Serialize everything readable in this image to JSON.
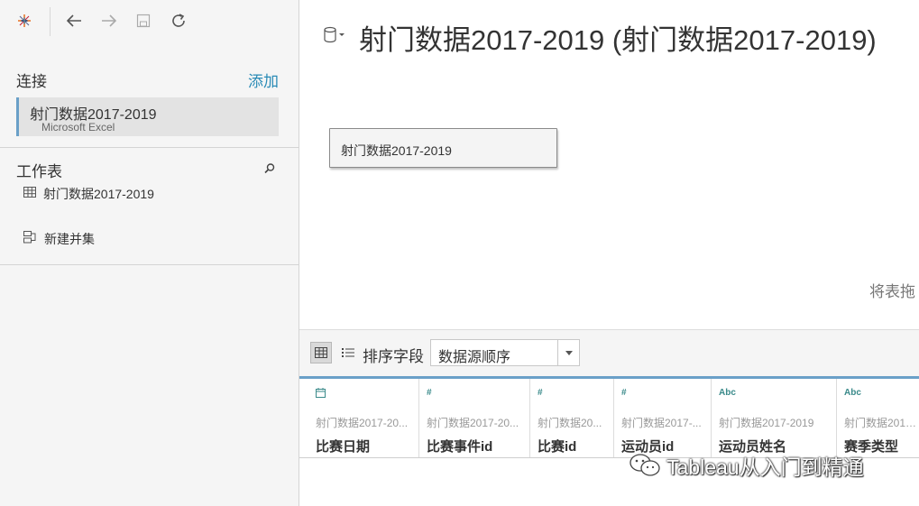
{
  "left_pane": {
    "connections_heading": "连接",
    "add_label": "添加",
    "connection": {
      "name": "射门数据2017-2019",
      "type": "Microsoft Excel"
    },
    "sheets_heading": "工作表",
    "sheet": {
      "name": "射门数据2017-2019",
      "icon": "table-icon"
    },
    "new_union": {
      "label": "新建并集",
      "icon": "union-icon"
    }
  },
  "canvas": {
    "datasource_title": "射门数据2017-2019 (射门数据2017-2019)",
    "table_box_label": "射门数据2017-2019",
    "drag_hint": "将表拖"
  },
  "grid_toolbar": {
    "sort_label": "排序字段",
    "sort_value": "数据源顺序"
  },
  "columns": [
    {
      "type_icon": "calendar-icon",
      "type_text": "",
      "source": "射门数据2017-20...",
      "name": "比赛日期"
    },
    {
      "type_icon": "number-icon",
      "type_text": "#",
      "source": "射门数据2017-20...",
      "name": "比赛事件id"
    },
    {
      "type_icon": "number-icon",
      "type_text": "#",
      "source": "射门数据20...",
      "name": "比赛id"
    },
    {
      "type_icon": "number-icon",
      "type_text": "#",
      "source": "射门数据2017-...",
      "name": "运动员id"
    },
    {
      "type_icon": "string-icon",
      "type_text": "Abc",
      "source": "射门数据2017-2019",
      "name": "运动员姓名"
    },
    {
      "type_icon": "string-icon",
      "type_text": "Abc",
      "source": "射门数据2017-...",
      "name": "赛季类型"
    }
  ],
  "watermark": "Tableau从入门到精通",
  "colors": {
    "accent": "#2a8bb6",
    "selection_bar": "#6aa0c8",
    "type_icon": "#3a8a8a"
  }
}
